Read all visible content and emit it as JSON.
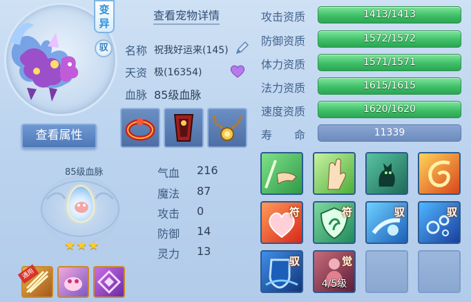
{
  "pet": {
    "variant_badge": [
      "变",
      "异"
    ],
    "tame_badge": "驭",
    "view_attr_button": "查看属性",
    "detail_link": "查看宠物详情",
    "name_label": "名称",
    "name_value": "祝我好运来(145)",
    "talent_label": "天资",
    "talent_value": "极(16354)",
    "bloodline_label": "血脉",
    "bloodline_value": "85级血脉"
  },
  "emblem": {
    "title": "85级血脉",
    "stars": "★★★"
  },
  "stats": [
    {
      "label": "气血",
      "value": "216"
    },
    {
      "label": "魔法",
      "value": "87"
    },
    {
      "label": "攻击",
      "value": "0"
    },
    {
      "label": "防御",
      "value": "14"
    },
    {
      "label": "灵力",
      "value": "13"
    }
  ],
  "aptitudes": [
    {
      "label": "攻击资质",
      "value": "1413/1413",
      "fill": 1.0
    },
    {
      "label": "防御资质",
      "value": "1572/1572",
      "fill": 1.0
    },
    {
      "label": "体力资质",
      "value": "1571/1571",
      "fill": 1.0
    },
    {
      "label": "法力资质",
      "value": "1615/1615",
      "fill": 1.0
    },
    {
      "label": "速度资质",
      "value": "1620/1620",
      "fill": 1.0
    }
  ],
  "life": {
    "label": "寿　　命",
    "value": "11339"
  },
  "skills": {
    "tag_fu": "符",
    "tag_yu": "驭",
    "tag_jue": "觉",
    "awaken_level": "4/5级"
  },
  "left_slots": {
    "first_ribbon": "通用"
  },
  "colors": {
    "accent_green": "#3fbf68",
    "panel_blue": "#bcd4ef",
    "star_gold": "#ffcc2a"
  }
}
